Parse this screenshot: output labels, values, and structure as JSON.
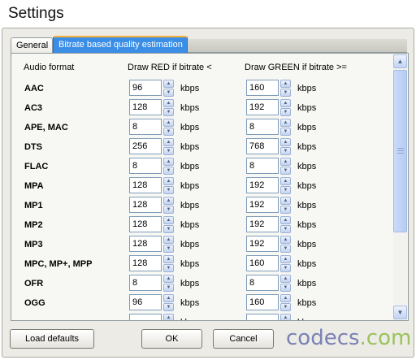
{
  "window": {
    "title": "Settings"
  },
  "tabs": [
    {
      "label": "General",
      "active": false
    },
    {
      "label": "Bitrate based quality estimation",
      "active": true
    }
  ],
  "headers": {
    "format": "Audio format",
    "red": "Draw RED if bitrate <",
    "green": "Draw GREEN if bitrate >="
  },
  "unit": "kbps",
  "rows": [
    {
      "format": "AAC",
      "red": "96",
      "green": "160"
    },
    {
      "format": "AC3",
      "red": "128",
      "green": "192"
    },
    {
      "format": "APE, MAC",
      "red": "8",
      "green": "8"
    },
    {
      "format": "DTS",
      "red": "256",
      "green": "768"
    },
    {
      "format": "FLAC",
      "red": "8",
      "green": "8"
    },
    {
      "format": "MPA",
      "red": "128",
      "green": "192"
    },
    {
      "format": "MP1",
      "red": "128",
      "green": "192"
    },
    {
      "format": "MP2",
      "red": "128",
      "green": "192"
    },
    {
      "format": "MP3",
      "red": "128",
      "green": "192"
    },
    {
      "format": "MPC, MP+, MPP",
      "red": "128",
      "green": "160"
    },
    {
      "format": "OFR",
      "red": "8",
      "green": "8"
    },
    {
      "format": "OGG",
      "red": "96",
      "green": "160"
    },
    {
      "format": "",
      "red": "",
      "green": ""
    }
  ],
  "buttons": {
    "load_defaults": "Load defaults",
    "ok": "OK",
    "cancel": "Cancel"
  },
  "logo": {
    "part1": "codecs",
    "part2": ".com"
  },
  "icons": {
    "spin_up": "▲",
    "spin_down": "▼",
    "scroll_up": "▲",
    "scroll_down": "▼"
  },
  "colors": {
    "active_tab": "#3a8ee6",
    "tab_highlight": "#f7b23b",
    "logo_main": "#7a81b6",
    "logo_tld": "#9bc25c"
  }
}
